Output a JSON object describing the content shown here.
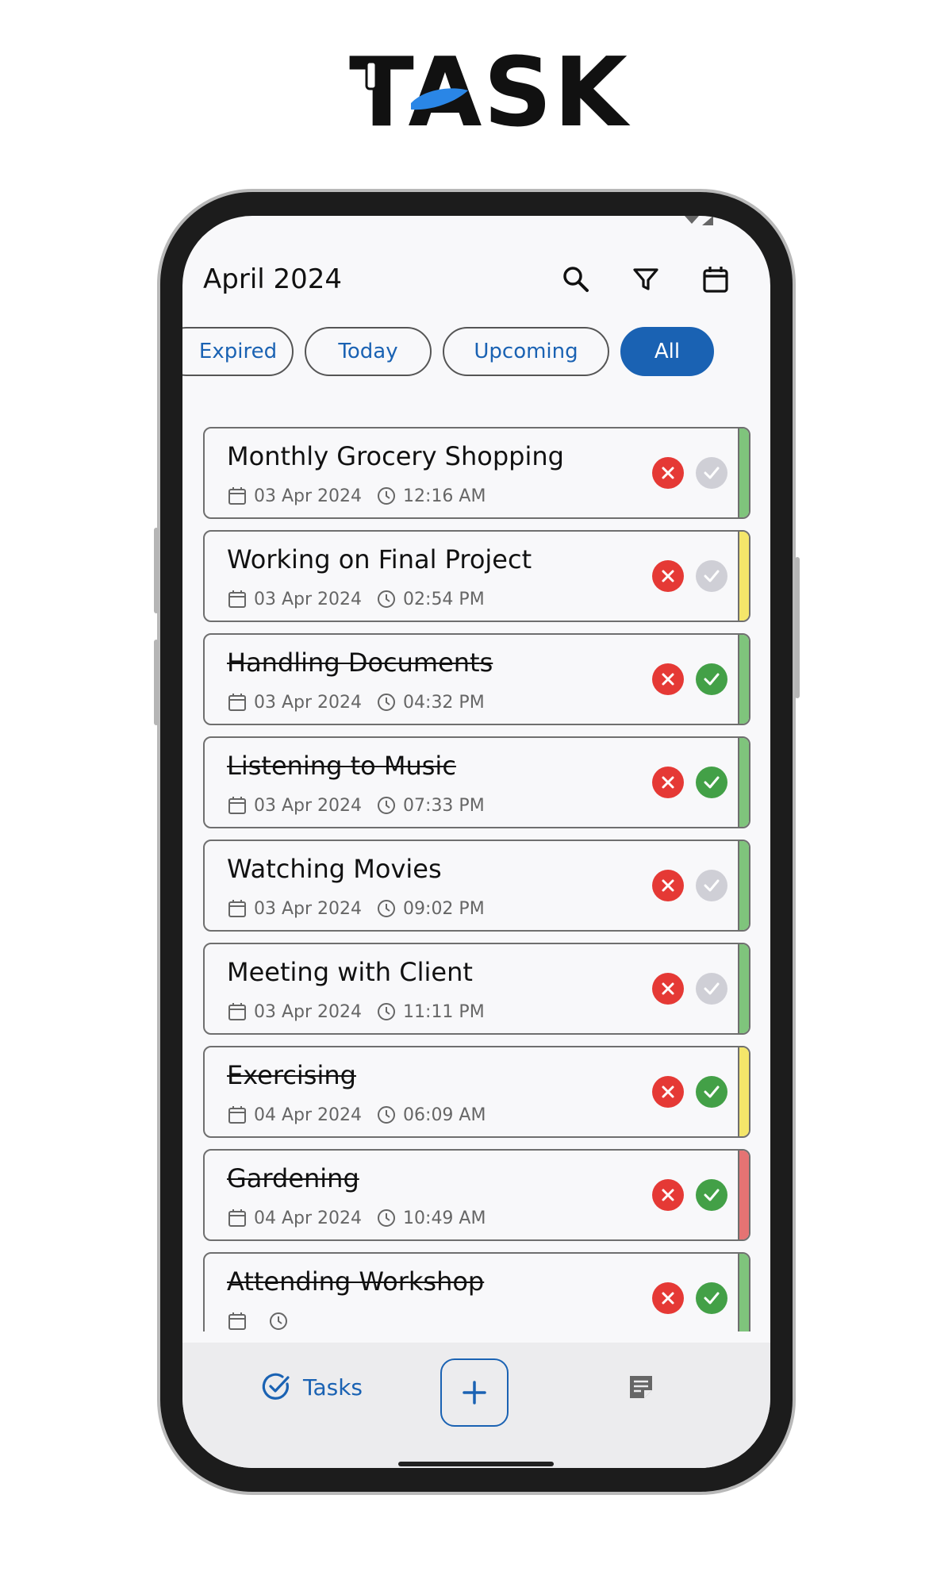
{
  "logo": {
    "text": "TASK"
  },
  "header": {
    "title": "April 2024"
  },
  "filters": [
    {
      "label": "Expired",
      "active": false
    },
    {
      "label": "Today",
      "active": false
    },
    {
      "label": "Upcoming",
      "active": false
    },
    {
      "label": "All",
      "active": true
    }
  ],
  "tasks": [
    {
      "title": "Monthly Grocery Shopping",
      "date": "03 Apr 2024",
      "time": "12:16 AM",
      "completed": false,
      "priority_color": "#7fc47c"
    },
    {
      "title": "Working on Final Project",
      "date": "03 Apr 2024",
      "time": "02:54 PM",
      "completed": false,
      "priority_color": "#f4e66a"
    },
    {
      "title": "Handling Documents",
      "date": "03 Apr 2024",
      "time": "04:32 PM",
      "completed": true,
      "priority_color": "#7fc47c"
    },
    {
      "title": "Listening to Music",
      "date": "03 Apr 2024",
      "time": "07:33 PM",
      "completed": true,
      "priority_color": "#7fc47c"
    },
    {
      "title": "Watching Movies",
      "date": "03 Apr 2024",
      "time": "09:02 PM",
      "completed": false,
      "priority_color": "#7fc47c"
    },
    {
      "title": "Meeting with Client",
      "date": "03 Apr 2024",
      "time": "11:11 PM",
      "completed": false,
      "priority_color": "#7fc47c"
    },
    {
      "title": "Exercising",
      "date": "04 Apr 2024",
      "time": "06:09 AM",
      "completed": true,
      "priority_color": "#f4e66a"
    },
    {
      "title": "Gardening",
      "date": "04 Apr 2024",
      "time": "10:49 AM",
      "completed": true,
      "priority_color": "#e57373"
    },
    {
      "title": "Attending Workshop",
      "date": "",
      "time": "",
      "completed": true,
      "priority_color": "#7fc47c"
    }
  ],
  "nav": {
    "tasks_label": "Tasks"
  },
  "icons": {
    "header": [
      "search-icon",
      "filter-icon",
      "calendar-icon"
    ],
    "task_meta": [
      "calendar-icon",
      "clock-icon"
    ],
    "task_actions": [
      "delete-icon",
      "check-icon"
    ],
    "nav": [
      "tasks-check-icon",
      "plus-icon",
      "notes-icon"
    ]
  },
  "colors": {
    "accent": "#1a62b3",
    "delete": "#e53935",
    "done": "#43a047",
    "pending": "#cfcfd6",
    "logo_accent": "#2a86e6"
  }
}
